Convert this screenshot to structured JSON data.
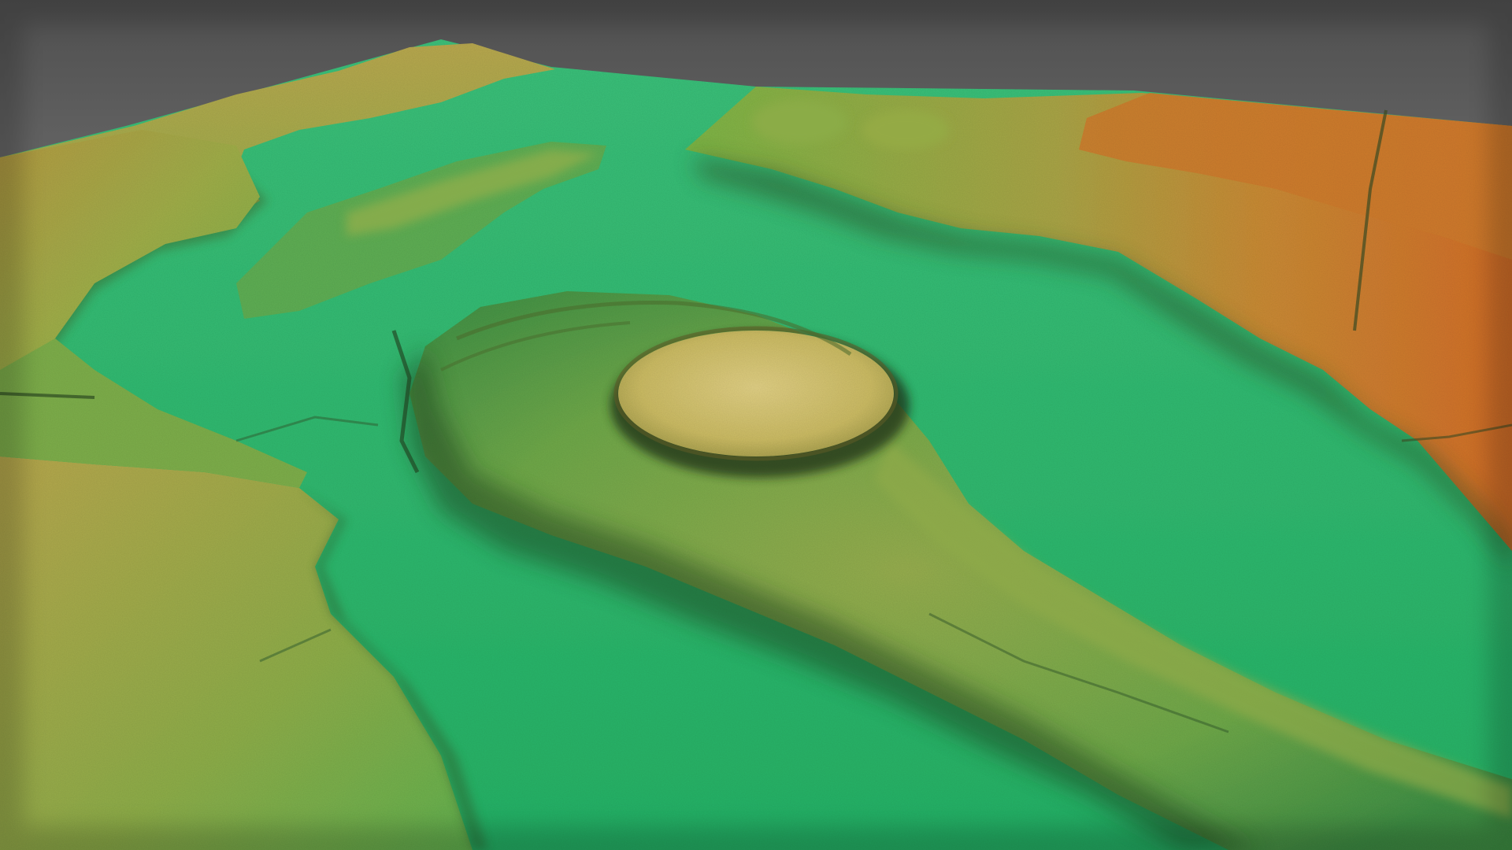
{
  "scene": {
    "kind": "lidar-terrain-3d-render",
    "colors": {
      "sky_top": "#5a5a5a",
      "sky_bottom": "#b3b3b3",
      "valley_floor": "#2fb86a",
      "valley_floor_light": "#3fc276",
      "slope_mid": "#6fb24c",
      "upland_yellow": "#c8bb5a",
      "upland_ochre": "#b89a42",
      "summit_orange": "#cf7a2e",
      "shadow": "#1f3a1a",
      "hilltop_pale": "#d9c879"
    }
  }
}
